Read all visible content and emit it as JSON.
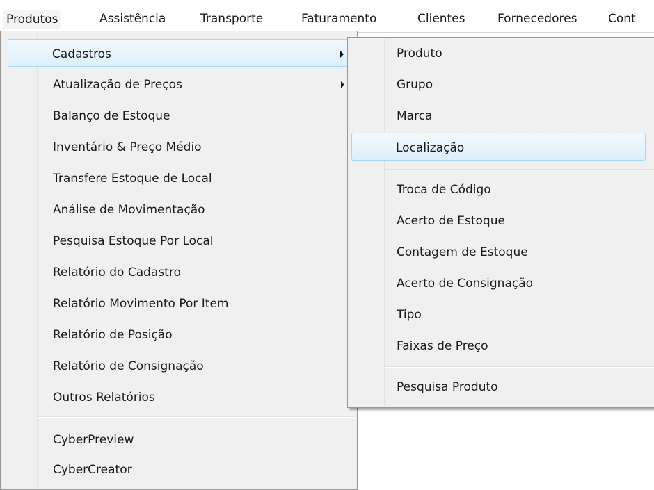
{
  "menubar": {
    "items": [
      "Produtos",
      "Assistência",
      "Transporte",
      "Faturamento",
      "Clientes",
      "Fornecedores",
      "Cont"
    ]
  },
  "main_menu": {
    "items": [
      {
        "label": "Cadastros",
        "submenu": true,
        "highlighted": true
      },
      {
        "label": "Atualização de Preços",
        "submenu": true
      },
      {
        "label": "Balanço de Estoque"
      },
      {
        "label": "Inventário & Preço Médio"
      },
      {
        "label": "Transfere Estoque de Local"
      },
      {
        "label": "Análise de Movimentação"
      },
      {
        "label": "Pesquisa Estoque Por Local"
      },
      {
        "label": "Relatório do Cadastro"
      },
      {
        "label": "Relatório Movimento Por Item"
      },
      {
        "label": "Relatório de Posição"
      },
      {
        "label": "Relatório de Consignação"
      },
      {
        "label": "Outros Relatórios"
      },
      {
        "label": "CyberPreview"
      },
      {
        "label": "CyberCreator"
      }
    ]
  },
  "sub_menu": {
    "items": [
      {
        "label": "Produto"
      },
      {
        "label": "Grupo"
      },
      {
        "label": "Marca"
      },
      {
        "label": "Localização",
        "highlighted": true
      },
      {
        "label": "Troca de Código"
      },
      {
        "label": "Acerto de Estoque"
      },
      {
        "label": "Contagem de Estoque"
      },
      {
        "label": "Acerto de Consignação"
      },
      {
        "label": "Tipo"
      },
      {
        "label": "Faixas de Preço"
      },
      {
        "label": "Pesquisa Produto"
      }
    ]
  },
  "colors": {
    "menu_bg": "#f0f0f0",
    "highlight_border": "#a8d8f0",
    "highlight_fill": "#dcf0fb"
  },
  "icons": [
    "submenu-arrow-icon"
  ]
}
